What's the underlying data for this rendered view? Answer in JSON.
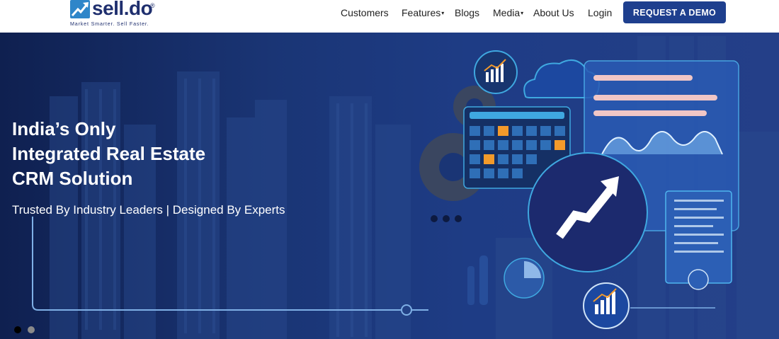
{
  "brand": {
    "name": "sell.do",
    "reg": "®",
    "tagline": "Market Smarter. Sell Faster."
  },
  "nav": {
    "items": [
      {
        "label": "Customers"
      },
      {
        "label": "Features",
        "dropdown": true
      },
      {
        "label": "Blogs"
      },
      {
        "label": "Media",
        "dropdown": true
      },
      {
        "label": "About Us"
      },
      {
        "label": "Login"
      }
    ],
    "caret": "▾",
    "cta": "REQUEST A DEMO"
  },
  "hero": {
    "headline": [
      "India’s Only",
      "Integrated Real Estate",
      "CRM Solution"
    ],
    "subheadline": "Trusted By Industry Leaders | Designed By Experts",
    "active_slide": 1,
    "slide_count": 2
  },
  "colors": {
    "brand_navy": "#1f2f6e",
    "cta_bg": "#1e3f8e",
    "hero_bg": "#1a3575",
    "accent_orange": "#f39a2b",
    "accent_light_blue": "#3fa8e0"
  }
}
